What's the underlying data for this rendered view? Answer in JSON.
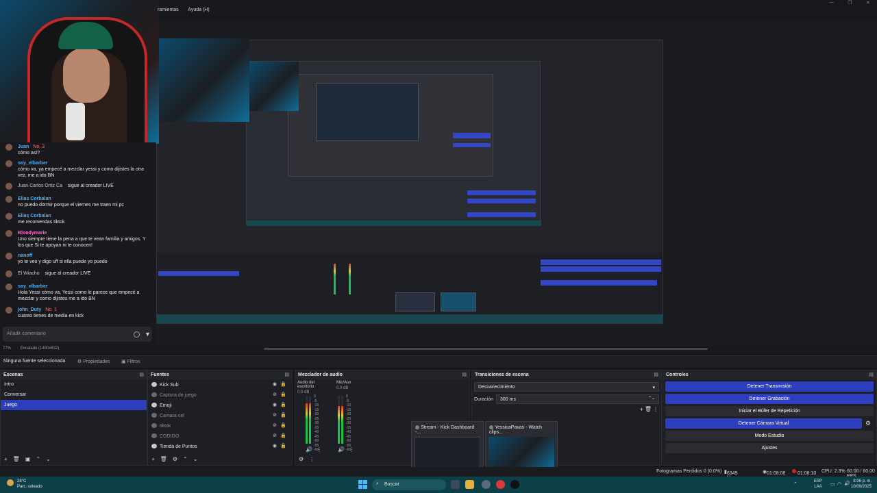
{
  "menu": {
    "items": [
      "ramientas",
      "Ayuda (H)"
    ]
  },
  "window_controls": {
    "minimize": "—",
    "maximize": "❐",
    "close": "✕"
  },
  "preview": {
    "zoom": "77%",
    "scale_label": "Escalado (1480x832)"
  },
  "chat": {
    "messages": [
      {
        "user": "Juan",
        "badges": "No. 3",
        "text": "cómo así?",
        "color": "blue"
      },
      {
        "user": "soy_elbarber",
        "text": "cómo va, ya empecé a mezclar yessi y como dijistes la otra vez, me a ido BN",
        "color": "blue"
      },
      {
        "user": "Juan Carlos Ortiz Ca",
        "text": "sigue al creador LIVE",
        "color": "gray",
        "inline": true
      },
      {
        "user": "Elias Corbalan",
        "text": "no puedo dormir porque el viernes me traen mi pc",
        "color": "blue"
      },
      {
        "user": "Elias Corbalan",
        "text": "me recomendas tiktok",
        "color": "blue"
      },
      {
        "user": "Bloodymarie",
        "text": "Uno siempre tiene la pena a que te vean familia y amigos. Y los que Si te apoyan ni te conocen!",
        "color": "pink"
      },
      {
        "user": "nanoff",
        "text": "yo te veo y digo uff si ella puede yo puedo",
        "color": "blue"
      },
      {
        "user": "El Wiacho",
        "text": "sigue al creador LIVE",
        "color": "gray",
        "inline": true
      },
      {
        "user": "soy_elbarber",
        "text": "Hola Yessi cómo va, Yessi como le parece que empecé a mezclar y como dijistes me a ido BN",
        "color": "blue"
      },
      {
        "user": "john_Duty",
        "badges": "No. 1",
        "text": "cuanto tienes de media en kick",
        "color": "blue"
      }
    ],
    "input_placeholder": "Añadir comentario"
  },
  "source_toolbar": {
    "no_source": "Ninguna fuente seleccionada",
    "properties": "Propiedades",
    "filters": "Filtros"
  },
  "scenes": {
    "title": "Escenas",
    "items": [
      "Intro",
      "Conversar",
      "Juego"
    ],
    "selected": 2
  },
  "sources": {
    "title": "Fuentes",
    "items": [
      {
        "label": "Kick Sub",
        "visible": true
      },
      {
        "label": "Captura de juego",
        "visible": false
      },
      {
        "label": "Emoji",
        "visible": true
      },
      {
        "label": "Camara cel",
        "visible": false
      },
      {
        "label": "tiktok",
        "visible": false
      },
      {
        "label": "CODIGO",
        "visible": false
      },
      {
        "label": "Tienda de Puntos",
        "visible": true
      }
    ]
  },
  "mixer": {
    "title": "Mezclador de audio",
    "channels": [
      {
        "name": "Audio del escritorio",
        "db": "0.0 dB",
        "level": 0.85
      },
      {
        "name": "Mic/Aux",
        "db": "0.0 dB",
        "level": 0.78
      }
    ],
    "scale": [
      "0",
      "-5",
      "-10",
      "-15",
      "-20",
      "-25",
      "-30",
      "-35",
      "-40",
      "-45",
      "-50",
      "-55",
      "-60"
    ]
  },
  "transitions": {
    "title": "Transiciones de escena",
    "selected": "Desvanecimiento",
    "duration_label": "Duración",
    "duration_value": "300 ms"
  },
  "thumbnails": [
    {
      "title": "Stream - Kick Dashboard -..."
    },
    {
      "title": "YessicaPavas - Watch clips..."
    }
  ],
  "controls": {
    "title": "Controles",
    "buttons": [
      {
        "label": "Detener Transmisión",
        "active": true
      },
      {
        "label": "Detener Grabación",
        "active": true
      },
      {
        "label": "Iniciar el Búfer de Repetición",
        "active": false
      },
      {
        "label": "Detener Cámara Virtual",
        "active": true
      },
      {
        "label": "Modo Estudio",
        "active": false
      },
      {
        "label": "Ajustes",
        "active": false
      }
    ]
  },
  "status": {
    "dropped": "Fotogramas Perdidos 0 (0.0%)",
    "bitrate": "6349 kbps",
    "stream_time": "01:08:08",
    "rec_time": "01:08:10",
    "cpu": "CPU: 2.3%",
    "fps": "60.00 / 60.00 FPS"
  },
  "taskbar": {
    "weather_temp": "28°C",
    "weather_desc": "Parc. soleado",
    "search": "Buscar",
    "lang": "ESP",
    "lang_sub": "LAA",
    "time": "8:06 p. m.",
    "date": "10/09/2025"
  },
  "colors": {
    "accent": "#2d3fbf",
    "taskbar": "#0c3f47"
  }
}
